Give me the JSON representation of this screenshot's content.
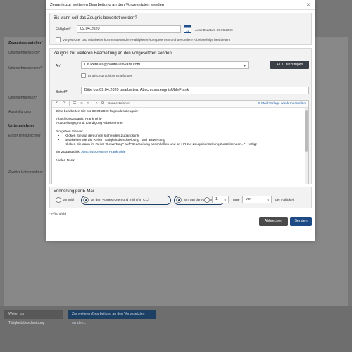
{
  "background": {
    "labels": [
      {
        "text": "Zeugnisaussteller*",
        "bold": true
      },
      {
        "text": "Unternehmensprofil*",
        "bold": false
      },
      {
        "text": "Unternehmensname*",
        "bold": false
      },
      {
        "text": "Unternehmensort*",
        "bold": false
      },
      {
        "text": "Ausstellungsort",
        "bold": false
      },
      {
        "text": "Unterzeichner",
        "bold": true
      },
      {
        "text": "Erster Unterzeichner",
        "bold": false
      },
      {
        "text": "Zweiter Unterzeichner",
        "bold": false
      }
    ],
    "footer_btn_left": "Weiter zur Tätigkeitsbeschreibung",
    "footer_btn_right": "Zur weiteren Bearbeitung an den Vorgesetzten senden..."
  },
  "modal": {
    "title": "Zeugnis zur weiteren Bearbeitung an den Vorgesetzten senden",
    "close_glyph": "×",
    "deadline": {
      "section_title": "Bis wann soll das Zeugnis bewertet werden?",
      "due_label": "Fälligkeit*",
      "due_value": "09.04.2020",
      "exit_date_text": "Austrittsdatum 30.06.2020",
      "calendar_day": "31",
      "checkbox_text": "Vorgesetzter und Mitarbeiter können Besondere Fähigkeiten/Kompetenzen und Besondere Arbeitserfolge bearbeiten."
    },
    "send": {
      "section_title": "Zeugnis zur weiteren Bearbeitung an den Vorgesetzten senden",
      "to_label": "An*",
      "to_value": "Ulf.Petereit@haufe-lexware.com",
      "cc_button": "+ CC hinzufügen",
      "english_recipient": "Englischsprachiger Empfänger",
      "subject_label": "Betreff*",
      "subject_value": "Bitte bis 09.04.2020 bearbeiten: AbschlusszeugnisUhleFrank",
      "toolbar_special": "Sonderzeichen",
      "restore_template": "E-Mail-Vorlage wiederherstellen",
      "body": {
        "line1": "Bitte bearbeiten Sie bis 09.04.2020 folgendes Zeugnis:",
        "line2": "Abschlusszeugnis: Frank Uhle",
        "line3": "Ausstellungsgrund: Kündigung Arbeitnehmer",
        "line4": "So gehen Sie vor:",
        "bullets": [
          "Klicken Sie auf den unten stehenden Zugangslink",
          "Bearbeiten Sie die Reiter \"Tätigkeitsbeschreibung\" und \"Bewertung\"",
          "Klicken Sie dann im Reiter \"Bewertung\" auf \"Bearbeitung abschließen und an HR zur Zeugniserstellung zurücksenden...\" - fertig!"
        ],
        "access_prefix": "Ihr Zugangslink: ",
        "access_link": "Abschlusszeugnis Frank Uhle",
        "closing": "Vielen Dank!"
      }
    },
    "reminder": {
      "section_title": "Erinnerung per E-Mail",
      "opt_me": "an mich",
      "opt_manager_me": "an den Vorgesetzten und mich (im CC)",
      "opt_due_day": "am Tag der Fälligkeit",
      "days_value": "1",
      "days_label": "Tage",
      "before_value": "vor",
      "due_suffix": "der Fälligkeit"
    },
    "required_note": "* Pflichtfeld",
    "cancel_label": "Abbrechen",
    "send_label": "Senden"
  }
}
